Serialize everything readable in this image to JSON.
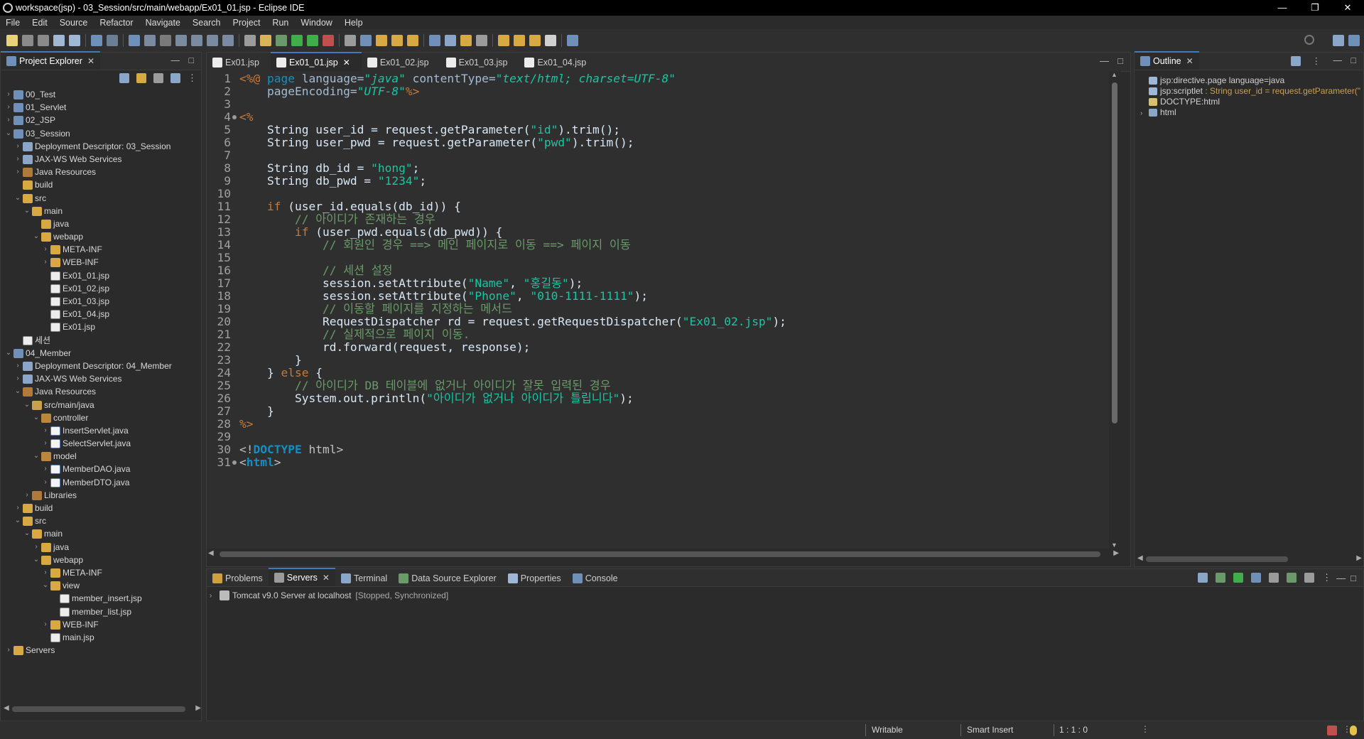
{
  "window": {
    "title": "workspace(jsp) - 03_Session/src/main/webapp/Ex01_01.jsp - Eclipse IDE",
    "controls": [
      "—",
      "❐",
      "✕"
    ]
  },
  "menu": [
    "File",
    "Edit",
    "Source",
    "Refactor",
    "Navigate",
    "Search",
    "Project",
    "Run",
    "Window",
    "Help"
  ],
  "project_explorer": {
    "title": "Project Explorer",
    "tree": [
      {
        "label": "00_Test",
        "depth": 0,
        "twisty": "›",
        "icon": "project"
      },
      {
        "label": "01_Servlet",
        "depth": 0,
        "twisty": "›",
        "icon": "project"
      },
      {
        "label": "02_JSP",
        "depth": 0,
        "twisty": "›",
        "icon": "project"
      },
      {
        "label": "03_Session",
        "depth": 0,
        "twisty": "⌄",
        "icon": "project"
      },
      {
        "label": "Deployment Descriptor: 03_Session",
        "depth": 1,
        "twisty": "›",
        "icon": "gear"
      },
      {
        "label": "JAX-WS Web Services",
        "depth": 1,
        "twisty": "›",
        "icon": "gear"
      },
      {
        "label": "Java Resources",
        "depth": 1,
        "twisty": "›",
        "icon": "lib"
      },
      {
        "label": "build",
        "depth": 1,
        "twisty": "",
        "icon": "folder"
      },
      {
        "label": "src",
        "depth": 1,
        "twisty": "⌄",
        "icon": "folder"
      },
      {
        "label": "main",
        "depth": 2,
        "twisty": "⌄",
        "icon": "folder"
      },
      {
        "label": "java",
        "depth": 3,
        "twisty": "",
        "icon": "folder"
      },
      {
        "label": "webapp",
        "depth": 3,
        "twisty": "⌄",
        "icon": "folder"
      },
      {
        "label": "META-INF",
        "depth": 4,
        "twisty": "›",
        "icon": "folder"
      },
      {
        "label": "WEB-INF",
        "depth": 4,
        "twisty": "›",
        "icon": "folder"
      },
      {
        "label": "Ex01_01.jsp",
        "depth": 4,
        "twisty": "",
        "icon": "file"
      },
      {
        "label": "Ex01_02.jsp",
        "depth": 4,
        "twisty": "",
        "icon": "file"
      },
      {
        "label": "Ex01_03.jsp",
        "depth": 4,
        "twisty": "",
        "icon": "file"
      },
      {
        "label": "Ex01_04.jsp",
        "depth": 4,
        "twisty": "",
        "icon": "file"
      },
      {
        "label": "Ex01.jsp",
        "depth": 4,
        "twisty": "",
        "icon": "file"
      },
      {
        "label": "세션",
        "depth": 1,
        "twisty": "",
        "icon": "file"
      },
      {
        "label": "04_Member",
        "depth": 0,
        "twisty": "⌄",
        "icon": "project"
      },
      {
        "label": "Deployment Descriptor: 04_Member",
        "depth": 1,
        "twisty": "›",
        "icon": "gear"
      },
      {
        "label": "JAX-WS Web Services",
        "depth": 1,
        "twisty": "›",
        "icon": "gear"
      },
      {
        "label": "Java Resources",
        "depth": 1,
        "twisty": "⌄",
        "icon": "lib"
      },
      {
        "label": "src/main/java",
        "depth": 2,
        "twisty": "⌄",
        "icon": "pkgfolder"
      },
      {
        "label": "controller",
        "depth": 3,
        "twisty": "⌄",
        "icon": "package"
      },
      {
        "label": "InsertServlet.java",
        "depth": 4,
        "twisty": "›",
        "icon": "java"
      },
      {
        "label": "SelectServlet.java",
        "depth": 4,
        "twisty": "›",
        "icon": "java"
      },
      {
        "label": "model",
        "depth": 3,
        "twisty": "⌄",
        "icon": "package"
      },
      {
        "label": "MemberDAO.java",
        "depth": 4,
        "twisty": "›",
        "icon": "java"
      },
      {
        "label": "MemberDTO.java",
        "depth": 4,
        "twisty": "›",
        "icon": "java"
      },
      {
        "label": "Libraries",
        "depth": 2,
        "twisty": "›",
        "icon": "lib"
      },
      {
        "label": "build",
        "depth": 1,
        "twisty": "›",
        "icon": "folder"
      },
      {
        "label": "src",
        "depth": 1,
        "twisty": "⌄",
        "icon": "folder"
      },
      {
        "label": "main",
        "depth": 2,
        "twisty": "⌄",
        "icon": "folder"
      },
      {
        "label": "java",
        "depth": 3,
        "twisty": "›",
        "icon": "folder"
      },
      {
        "label": "webapp",
        "depth": 3,
        "twisty": "⌄",
        "icon": "folder"
      },
      {
        "label": "META-INF",
        "depth": 4,
        "twisty": "›",
        "icon": "folder"
      },
      {
        "label": "view",
        "depth": 4,
        "twisty": "⌄",
        "icon": "folder"
      },
      {
        "label": "member_insert.jsp",
        "depth": 5,
        "twisty": "",
        "icon": "file"
      },
      {
        "label": "member_list.jsp",
        "depth": 5,
        "twisty": "",
        "icon": "file"
      },
      {
        "label": "WEB-INF",
        "depth": 4,
        "twisty": "›",
        "icon": "folder"
      },
      {
        "label": "main.jsp",
        "depth": 4,
        "twisty": "",
        "icon": "file"
      },
      {
        "label": "Servers",
        "depth": 0,
        "twisty": "›",
        "icon": "folder"
      }
    ]
  },
  "editor": {
    "tabs": [
      {
        "label": "Ex01.jsp",
        "active": false
      },
      {
        "label": "Ex01_01.jsp",
        "active": true
      },
      {
        "label": "Ex01_02.jsp",
        "active": false
      },
      {
        "label": "Ex01_03.jsp",
        "active": false
      },
      {
        "label": "Ex01_04.jsp",
        "active": false
      }
    ],
    "lines": [
      {
        "n": "1",
        "fold": false,
        "parts": [
          [
            "jspd",
            "<%@ "
          ],
          [
            "kw2",
            "page "
          ],
          [
            "atr",
            "language="
          ],
          [
            "ital",
            "\"java\" "
          ],
          [
            "atr",
            "contentType="
          ],
          [
            "ital",
            "\"text/html; charset=UTF-8\""
          ]
        ]
      },
      {
        "n": "2",
        "fold": false,
        "parts": [
          [
            "atr",
            "    pageEncoding="
          ],
          [
            "ital",
            "\"UTF-8\""
          ],
          [
            "jspd",
            "%>"
          ]
        ]
      },
      {
        "n": "3",
        "fold": false,
        "parts": []
      },
      {
        "n": "4",
        "fold": true,
        "parts": [
          [
            "jspd",
            "<%"
          ]
        ]
      },
      {
        "n": "5",
        "fold": false,
        "parts": [
          [
            "",
            "    String user_id = request.getParameter("
          ],
          [
            "str",
            "\"id\""
          ],
          [
            "",
            ").trim();"
          ]
        ]
      },
      {
        "n": "6",
        "fold": false,
        "parts": [
          [
            "",
            "    String user_pwd = request.getParameter("
          ],
          [
            "str",
            "\"pwd\""
          ],
          [
            "",
            ").trim();"
          ]
        ]
      },
      {
        "n": "7",
        "fold": false,
        "parts": []
      },
      {
        "n": "8",
        "fold": false,
        "parts": [
          [
            "",
            "    String db_id = "
          ],
          [
            "str",
            "\"hong\""
          ],
          [
            "",
            ";"
          ]
        ]
      },
      {
        "n": "9",
        "fold": false,
        "parts": [
          [
            "",
            "    String db_pwd = "
          ],
          [
            "str",
            "\"1234\""
          ],
          [
            "",
            ";"
          ]
        ]
      },
      {
        "n": "10",
        "fold": false,
        "parts": []
      },
      {
        "n": "11",
        "fold": false,
        "parts": [
          [
            "kw",
            "    if "
          ],
          [
            "",
            "(user_id.equals(db_id)) {"
          ]
        ]
      },
      {
        "n": "12",
        "fold": false,
        "parts": [
          [
            "cmtk",
            "        // 아이디가 존재하는 경우"
          ]
        ]
      },
      {
        "n": "13",
        "fold": false,
        "parts": [
          [
            "kw",
            "        if "
          ],
          [
            "",
            "(user_pwd.equals(db_pwd)) {"
          ]
        ]
      },
      {
        "n": "14",
        "fold": false,
        "parts": [
          [
            "cmtk",
            "            // 회원인 경우 ==> 메인 페이지로 이동 ==> 페이지 이동"
          ]
        ]
      },
      {
        "n": "15",
        "fold": false,
        "parts": []
      },
      {
        "n": "16",
        "fold": false,
        "parts": [
          [
            "cmtk",
            "            // 세션 설정"
          ]
        ]
      },
      {
        "n": "17",
        "fold": false,
        "parts": [
          [
            "",
            "            session.setAttribute("
          ],
          [
            "str",
            "\"Name\""
          ],
          [
            "",
            ", "
          ],
          [
            "str",
            "\"홍길동\""
          ],
          [
            "",
            ");"
          ]
        ]
      },
      {
        "n": "18",
        "fold": false,
        "parts": [
          [
            "",
            "            session.setAttribute("
          ],
          [
            "str",
            "\"Phone\""
          ],
          [
            "",
            ", "
          ],
          [
            "str",
            "\"010-1111-1111\""
          ],
          [
            "",
            ");"
          ]
        ]
      },
      {
        "n": "19",
        "fold": false,
        "parts": [
          [
            "cmtk",
            "            // 이동할 페이지를 지정하는 메서드"
          ]
        ]
      },
      {
        "n": "20",
        "fold": false,
        "parts": [
          [
            "",
            "            RequestDispatcher rd = request.getRequestDispatcher("
          ],
          [
            "str",
            "\"Ex01_02.jsp\""
          ],
          [
            "",
            ");"
          ]
        ]
      },
      {
        "n": "21",
        "fold": false,
        "parts": [
          [
            "cmtk",
            "            // 실제적으로 페이지 이동."
          ]
        ]
      },
      {
        "n": "22",
        "fold": false,
        "parts": [
          [
            "",
            "            rd.forward(request, response);"
          ]
        ]
      },
      {
        "n": "23",
        "fold": false,
        "parts": [
          [
            "",
            "        }"
          ]
        ]
      },
      {
        "n": "24",
        "fold": false,
        "parts": [
          [
            "",
            "    } "
          ],
          [
            "kw",
            "else "
          ],
          [
            "",
            "{"
          ]
        ]
      },
      {
        "n": "25",
        "fold": false,
        "parts": [
          [
            "cmtk",
            "        // 아이디가 DB 테이블에 없거나 아이디가 잘못 입력된 경우"
          ]
        ]
      },
      {
        "n": "26",
        "fold": false,
        "parts": [
          [
            "",
            "        System.out.println("
          ],
          [
            "str",
            "\"아이디가 없거나 아이디가 틀립니다\""
          ],
          [
            "",
            ");"
          ]
        ]
      },
      {
        "n": "27",
        "fold": false,
        "parts": [
          [
            "",
            "    }"
          ]
        ]
      },
      {
        "n": "28",
        "fold": false,
        "parts": [
          [
            "jspd",
            "%>"
          ]
        ]
      },
      {
        "n": "29",
        "fold": false,
        "parts": []
      },
      {
        "n": "30",
        "fold": false,
        "parts": [
          [
            "tag",
            "<!"
          ],
          [
            "tagb",
            "DOCTYPE "
          ],
          [
            "tag",
            "html>"
          ]
        ]
      },
      {
        "n": "31",
        "fold": true,
        "parts": [
          [
            "tag",
            "<"
          ],
          [
            "tagb",
            "html"
          ],
          [
            "tag",
            ">"
          ]
        ]
      }
    ]
  },
  "outline": {
    "title": "Outline",
    "items": [
      {
        "label": "jsp:directive.page language=java",
        "extra": "",
        "twisty": "",
        "icon": "tag"
      },
      {
        "label": "jsp:scriptlet",
        "extra": " : String user_id = request.getParameter(\"",
        "twisty": "",
        "icon": "tag"
      },
      {
        "label": "DOCTYPE:html",
        "extra": "",
        "twisty": "",
        "icon": "doc"
      },
      {
        "label": "html",
        "extra": "",
        "twisty": "›",
        "icon": "html"
      }
    ]
  },
  "bottom_panel": {
    "tabs": [
      {
        "label": "Problems",
        "active": false
      },
      {
        "label": "Servers",
        "active": true
      },
      {
        "label": "Terminal",
        "active": false
      },
      {
        "label": "Data Source Explorer",
        "active": false
      },
      {
        "label": "Properties",
        "active": false
      },
      {
        "label": "Console",
        "active": false
      }
    ],
    "server": {
      "name": "Tomcat v9.0 Server at localhost",
      "state": "[Stopped, Synchronized]"
    }
  },
  "status_bar": {
    "mode": "Writable",
    "insert": "Smart Insert",
    "position": "1 : 1 : 0"
  },
  "colors": {
    "background": "#2f2f2f",
    "accent": "#3e7bbf",
    "keyword": "#cc7832",
    "string": "#17c6a3"
  }
}
